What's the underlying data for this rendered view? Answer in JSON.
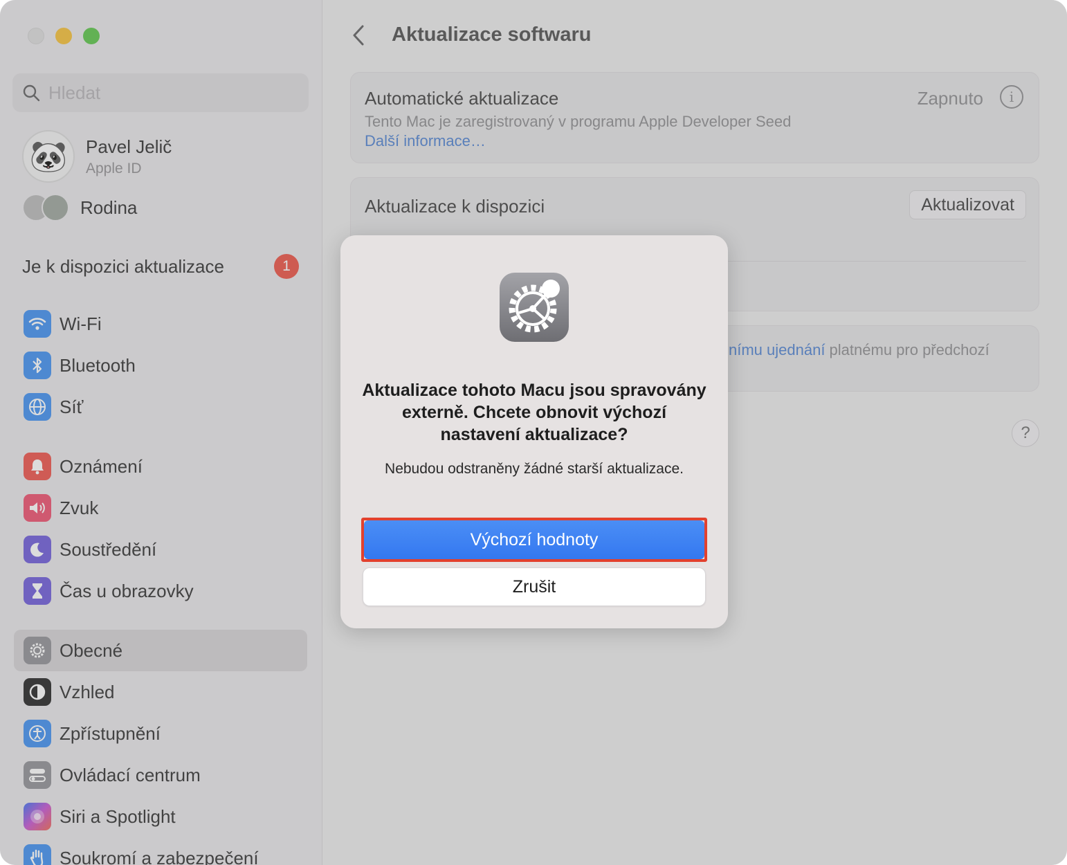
{
  "sidebar": {
    "search_placeholder": "Hledat",
    "profile": {
      "name": "Pavel Jelič",
      "subtitle": "Apple ID"
    },
    "family_label": "Rodina",
    "update_notice": {
      "label": "Je k dispozici aktualizace",
      "badge": "1"
    },
    "group1": [
      {
        "label": "Wi-Fi",
        "icon": "wifi-icon",
        "color": "#3b8df0"
      },
      {
        "label": "Bluetooth",
        "icon": "bluetooth-icon",
        "color": "#3b8df0"
      },
      {
        "label": "Síť",
        "icon": "globe-icon",
        "color": "#3b8df0"
      }
    ],
    "group2": [
      {
        "label": "Oznámení",
        "icon": "bell-icon",
        "color": "#ee4d45"
      },
      {
        "label": "Zvuk",
        "icon": "speaker-icon",
        "color": "#ee4a6a"
      },
      {
        "label": "Soustředění",
        "icon": "moon-icon",
        "color": "#6a56d8"
      },
      {
        "label": "Čas u obrazovky",
        "icon": "hourglass-icon",
        "color": "#6a56d8"
      }
    ],
    "group3": [
      {
        "label": "Obecné",
        "icon": "gear-icon",
        "color": "#8e8e93",
        "selected": true
      },
      {
        "label": "Vzhled",
        "icon": "appearance-icon",
        "color": "#1e1e1e"
      },
      {
        "label": "Zpřístupnění",
        "icon": "accessibility-icon",
        "color": "#3b8df0"
      },
      {
        "label": "Ovládací centrum",
        "icon": "toggles-icon",
        "color": "#8e8e93"
      },
      {
        "label": "Siri a Spotlight",
        "icon": "siri-icon",
        "color": "#9a4fd8"
      },
      {
        "label": "Soukromí a zabezpečení",
        "icon": "hand-icon",
        "color": "#3b8df0"
      }
    ]
  },
  "main": {
    "title": "Aktualizace softwaru",
    "auto_updates": {
      "title": "Automatické aktualizace",
      "status": "Zapnuto",
      "subtitle": "Tento Mac je zaregistrovaný v programu Apple Developer Seed",
      "link": "Další informace…"
    },
    "available": {
      "title": "Aktualizace k dispozici",
      "button": "Aktualizovat"
    },
    "license": {
      "link": "nímu ujednání",
      "text": " platnému pro předchozí"
    },
    "help": "?"
  },
  "dialog": {
    "title": "Aktualizace tohoto Macu jsou spravovány externě. Chcete obnovit výchozí nastavení aktualizace?",
    "message": "Nebudou odstraněny žádné starší aktualizace.",
    "primary_button": "Výchozí hodnoty",
    "secondary_button": "Zrušit"
  }
}
